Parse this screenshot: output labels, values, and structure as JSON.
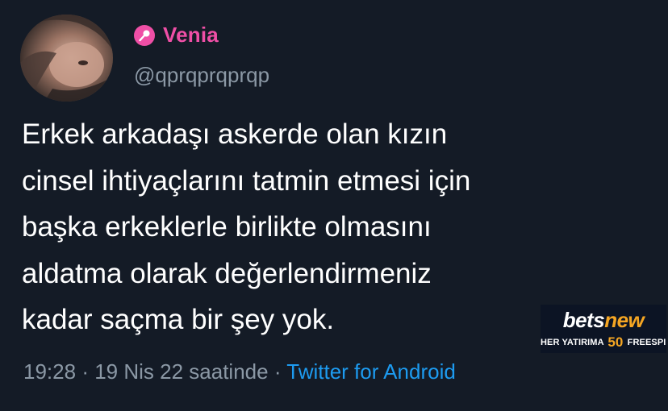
{
  "user": {
    "display_name": "Venia",
    "handle": "@qprqprqprqp",
    "name_icon": "microphone-icon",
    "name_color": "#ef4fa6"
  },
  "tweet": {
    "lines": [
      "Erkek arkadaşı askerde olan kızın",
      "cinsel ihtiyaçlarını tatmin etmesi için",
      "başka erkeklerle birlikte olmasını",
      "aldatma olarak değerlendirmeniz",
      "kadar saçma bir şey yok."
    ],
    "time": "19:28",
    "separator": "·",
    "date": "19 Nis 22 saatinde",
    "source": "Twitter for Android",
    "source_color": "#1d9bf0"
  },
  "ad": {
    "logo_prefix": "bets",
    "logo_suffix": "new",
    "tagline_before": "HER YATIRIMA",
    "tagline_number": "50",
    "tagline_after": "FREESPIN",
    "accent_color": "#f5a623"
  }
}
